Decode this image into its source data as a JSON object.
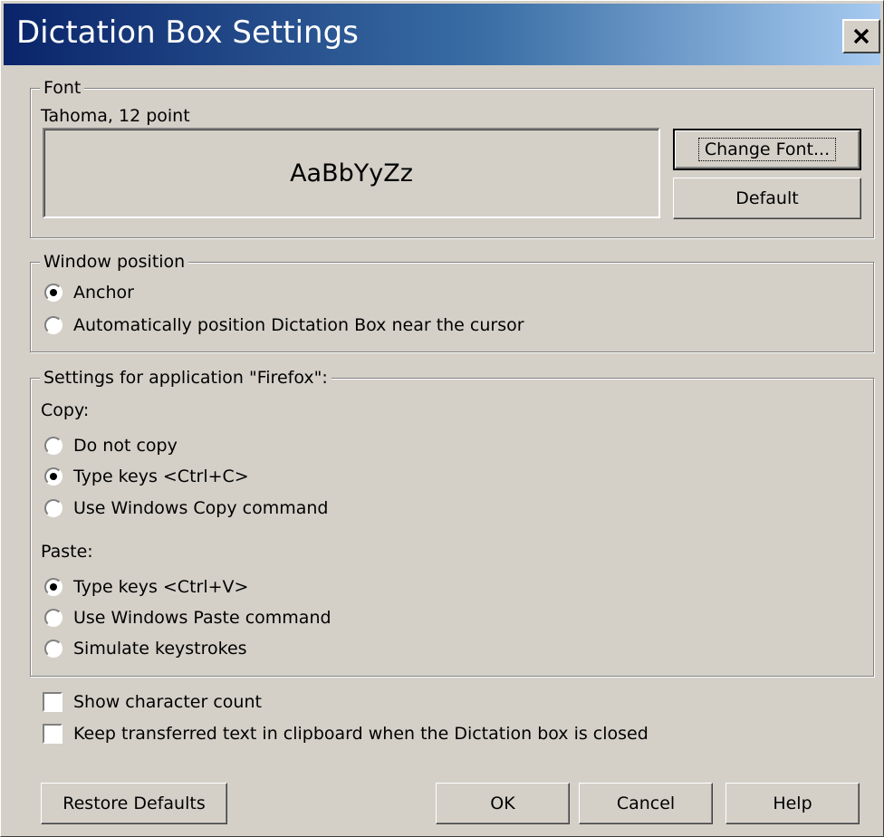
{
  "window": {
    "title": "Dictation Box Settings",
    "close_glyph": "✕"
  },
  "font_group": {
    "legend": "Font",
    "current_font": "Tahoma, 12 point",
    "preview_text": "AaBbYyZz",
    "change_font_label": "Change Font...",
    "default_label": "Default"
  },
  "position_group": {
    "legend": "Window position",
    "options": [
      {
        "label": "Anchor",
        "checked": true
      },
      {
        "label": "Automatically position Dictation Box near the cursor",
        "checked": false
      }
    ]
  },
  "app_group": {
    "legend": "Settings for application \"Firefox\":",
    "copy_label": "Copy:",
    "copy_options": [
      {
        "label": "Do not copy",
        "checked": false
      },
      {
        "label": "Type keys <Ctrl+C>",
        "checked": true
      },
      {
        "label": "Use Windows Copy command",
        "checked": false
      }
    ],
    "paste_label": "Paste:",
    "paste_options": [
      {
        "label": "Type keys <Ctrl+V>",
        "checked": true
      },
      {
        "label": "Use Windows Paste command",
        "checked": false
      },
      {
        "label": "Simulate keystrokes",
        "checked": false
      }
    ]
  },
  "checkboxes": [
    {
      "label": "Show character count",
      "checked": false
    },
    {
      "label": "Keep transferred text in clipboard when the Dictation box is closed",
      "checked": false
    }
  ],
  "buttons": {
    "restore_defaults": "Restore Defaults",
    "ok": "OK",
    "cancel": "Cancel",
    "help": "Help"
  },
  "colors": {
    "title_start": "#0a246a",
    "title_end": "#a6caf0",
    "face": "#d4d0c8"
  }
}
